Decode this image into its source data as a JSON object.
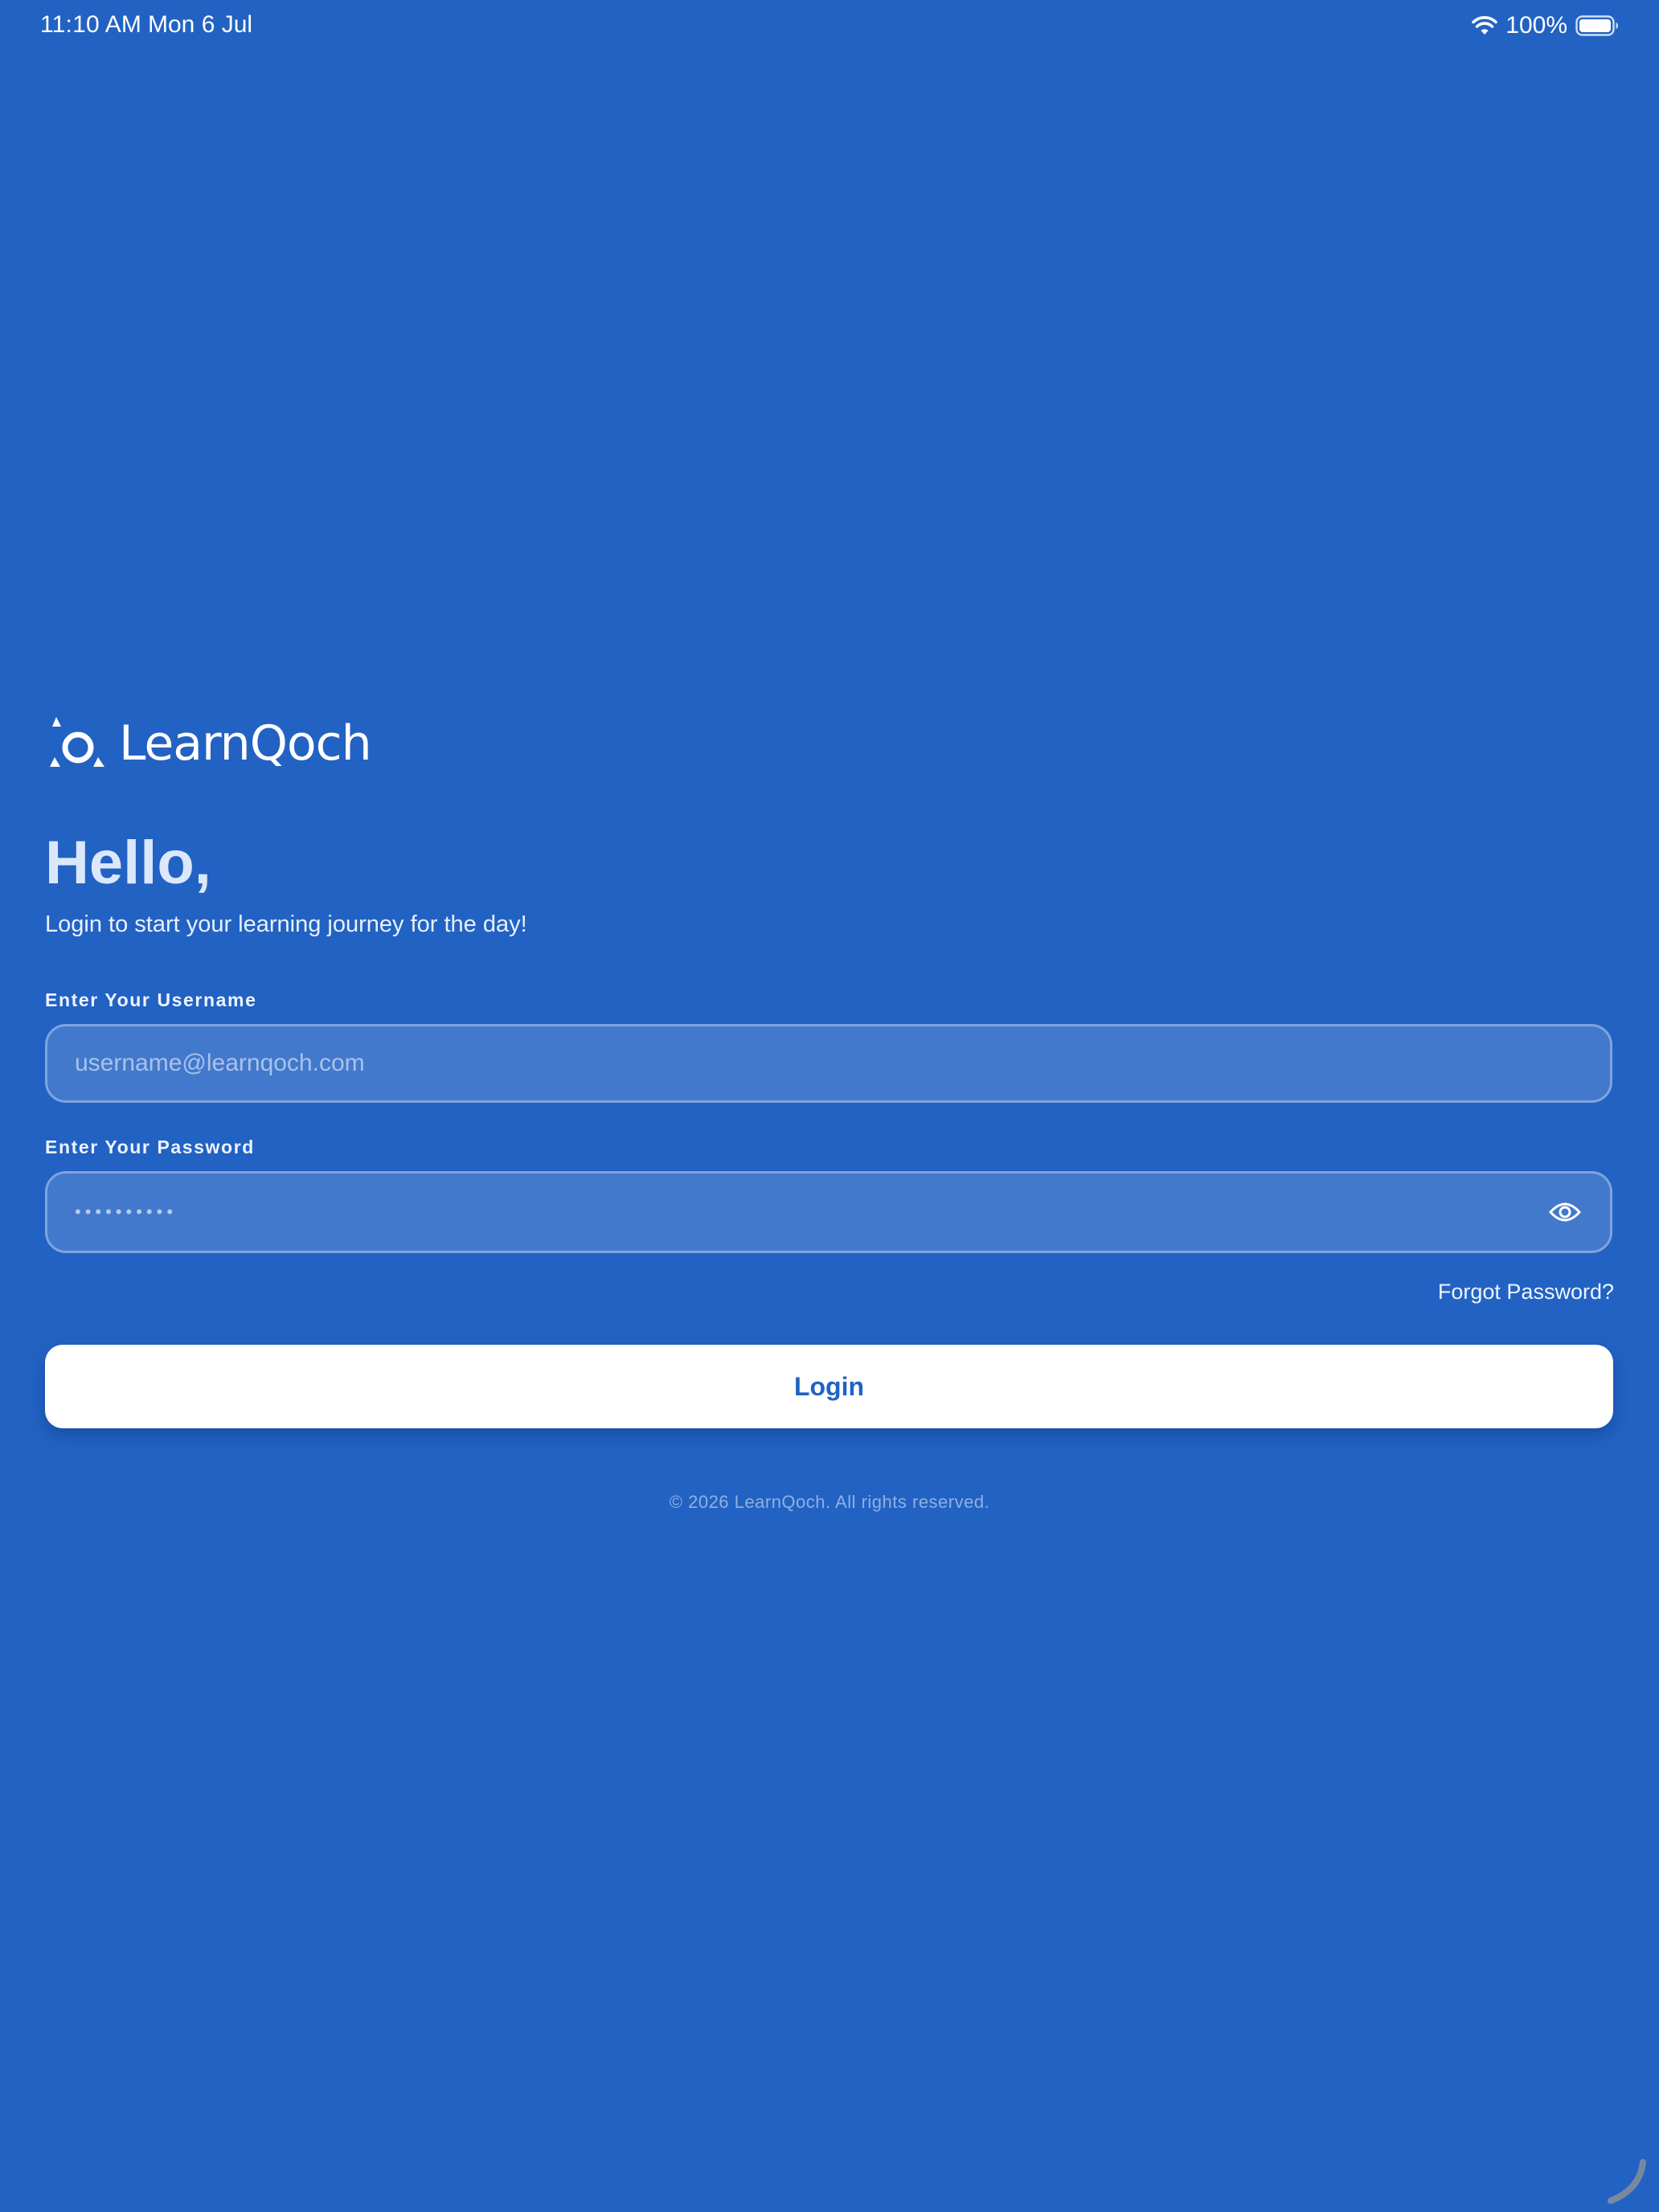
{
  "status_bar": {
    "time": "11:10 AM",
    "date": "Mon 6 Jul",
    "battery": "100%",
    "icons": [
      "wifi-icon",
      "battery-icon"
    ]
  },
  "brand": {
    "name": "LearnQoch",
    "logo_icon": "learnqoch-logo-mark"
  },
  "greeting": {
    "title": "Hello,",
    "subtitle": "Login to start your learning journey for the day!"
  },
  "form": {
    "username_label": "Enter Your Username",
    "username_placeholder": "username@learnqoch.com",
    "username_value": "",
    "password_label": "Enter Your Password",
    "password_value_masked": "••••••••••",
    "password_toggle_icon": "eye-icon",
    "forgot_password": "Forgot Password?",
    "login_button": "Login"
  },
  "footer": {
    "copyright": "© 2026 LearnQoch. All rights reserved."
  },
  "colors": {
    "background": "#2262c3",
    "input_fill": "#4279cc",
    "input_border": "#7fa4de",
    "button_fill": "#ffffff",
    "button_text": "#2262c3"
  }
}
